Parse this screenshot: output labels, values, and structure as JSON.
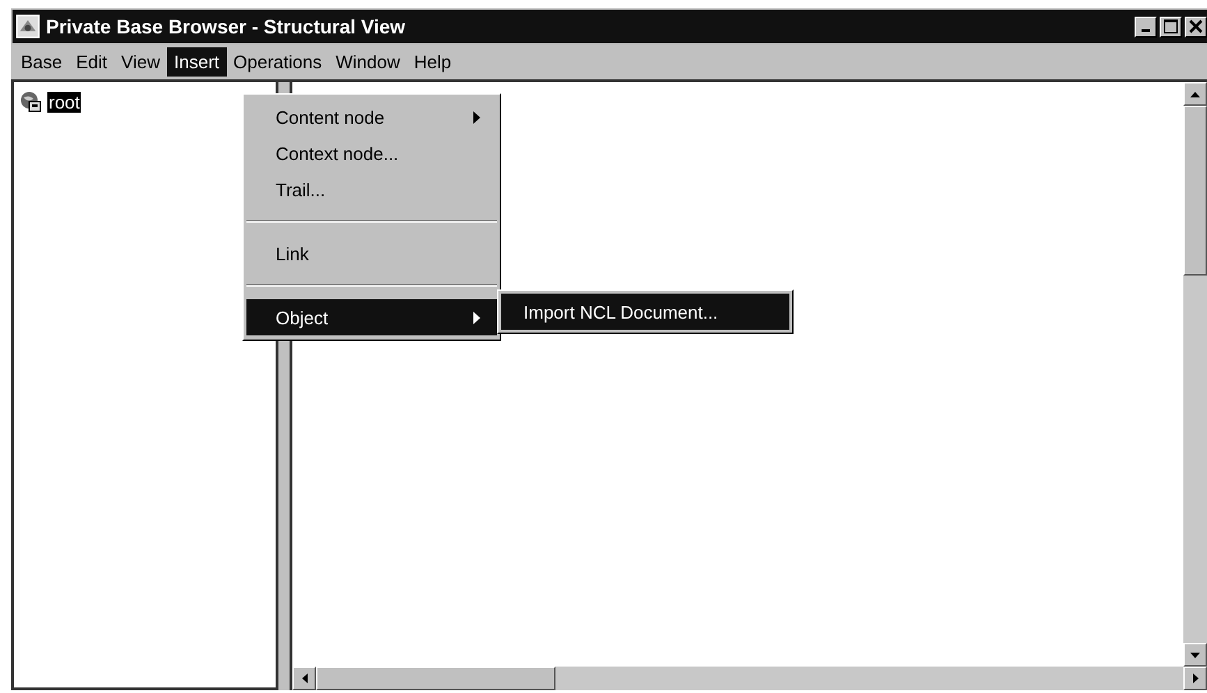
{
  "window": {
    "title": "Private Base Browser - Structural View"
  },
  "menu_bar": [
    {
      "label": "Base",
      "selected": false
    },
    {
      "label": "Edit",
      "selected": false
    },
    {
      "label": "View",
      "selected": false
    },
    {
      "label": "Insert",
      "selected": true
    },
    {
      "label": "Operations",
      "selected": false
    },
    {
      "label": "Window",
      "selected": false
    },
    {
      "label": "Help",
      "selected": false
    }
  ],
  "tree": [
    {
      "label": "root",
      "selected": true
    }
  ],
  "insert_menu": [
    {
      "kind": "item",
      "label": "Content node",
      "submenu": true,
      "selected": false
    },
    {
      "kind": "item",
      "label": "Context node...",
      "submenu": false,
      "selected": false
    },
    {
      "kind": "item",
      "label": "Trail...",
      "submenu": false,
      "selected": false
    },
    {
      "kind": "separator"
    },
    {
      "kind": "item",
      "label": "Link",
      "submenu": false,
      "selected": false
    },
    {
      "kind": "separator"
    },
    {
      "kind": "item",
      "label": "Object",
      "submenu": true,
      "selected": true
    }
  ],
  "object_submenu": [
    {
      "label": "Import NCL Document...",
      "selected": true
    }
  ]
}
